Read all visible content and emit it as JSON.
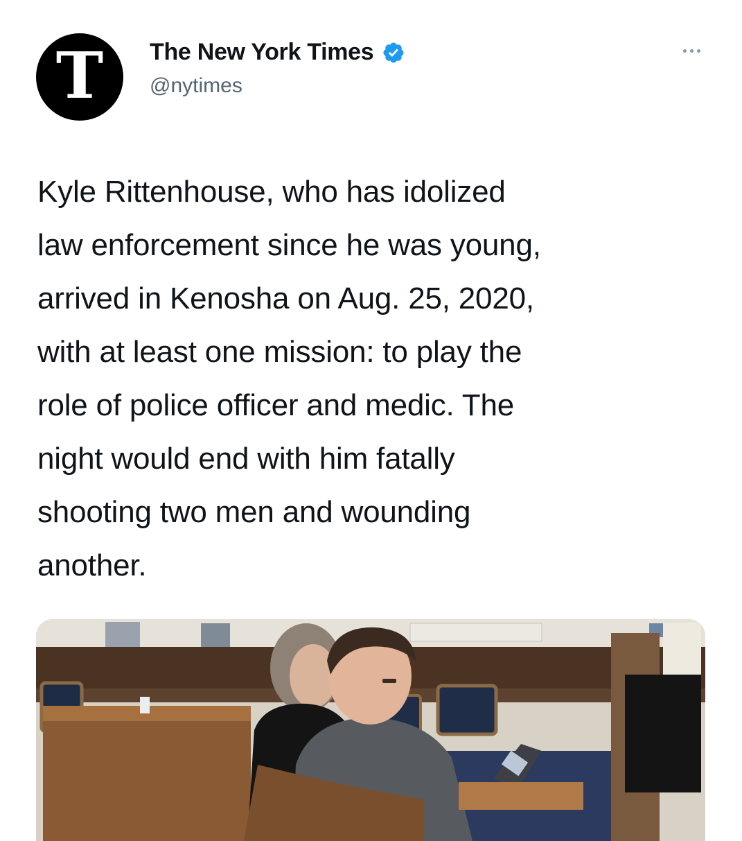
{
  "tweet": {
    "author": {
      "display_name": "The New York Times",
      "handle": "@nytimes",
      "avatar_glyph": "T",
      "verified": true,
      "avatar_icon": "nyt-logo-icon",
      "verified_icon": "verified-badge-icon"
    },
    "more_icon": "more-options-icon",
    "text": "Kyle Rittenhouse, who has idolized\nlaw enforcement since he was young,\narrived in Kenosha on Aug. 25, 2020,\nwith at least one mission: to play the\nrole of police officer and medic. The\nnight would end with him fatally\nshooting two men and wounding\nanother.",
    "media": {
      "kind": "photo",
      "subject": "courtroom-photo"
    }
  },
  "colors": {
    "text_primary": "#0f1419",
    "text_secondary": "#536471",
    "verified_blue": "#1d9bf0",
    "background": "#ffffff"
  }
}
